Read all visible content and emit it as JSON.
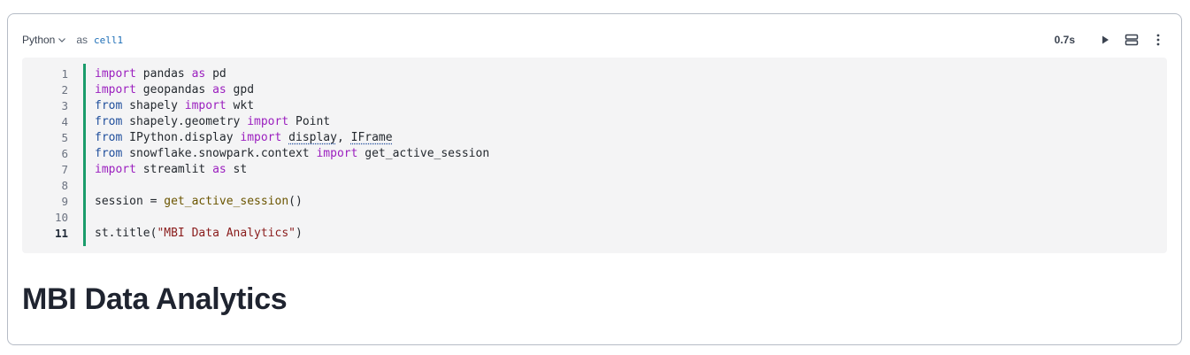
{
  "header": {
    "language": "Python",
    "as_word": "as",
    "cell_name": "cell1",
    "duration": "0.7s",
    "icons": {
      "language_dropdown": "chevron-down-icon",
      "run": "play-icon",
      "layout": "split-icon",
      "more": "more-vertical-icon"
    }
  },
  "editor": {
    "line_numbers": [
      "1",
      "2",
      "3",
      "4",
      "5",
      "6",
      "7",
      "8",
      "9",
      "10",
      "11"
    ],
    "active_line": "11",
    "accent_color": "#1a9c6b",
    "lines": [
      [
        {
          "t": "import",
          "c": "kw"
        },
        {
          "t": " pandas ",
          "c": ""
        },
        {
          "t": "as",
          "c": "kw"
        },
        {
          "t": " pd",
          "c": ""
        }
      ],
      [
        {
          "t": "import",
          "c": "kw"
        },
        {
          "t": " geopandas ",
          "c": ""
        },
        {
          "t": "as",
          "c": "kw"
        },
        {
          "t": " gpd",
          "c": ""
        }
      ],
      [
        {
          "t": "from",
          "c": "kw2"
        },
        {
          "t": " shapely ",
          "c": ""
        },
        {
          "t": "import",
          "c": "kw"
        },
        {
          "t": " wkt",
          "c": ""
        }
      ],
      [
        {
          "t": "from",
          "c": "kw2"
        },
        {
          "t": " shapely.geometry ",
          "c": ""
        },
        {
          "t": "import",
          "c": "kw"
        },
        {
          "t": " Point",
          "c": ""
        }
      ],
      [
        {
          "t": "from",
          "c": "kw2"
        },
        {
          "t": " IPython.display ",
          "c": ""
        },
        {
          "t": "import",
          "c": "kw"
        },
        {
          "t": " ",
          "c": ""
        },
        {
          "t": "display",
          "c": "und"
        },
        {
          "t": ", ",
          "c": ""
        },
        {
          "t": "IFrame",
          "c": "und"
        }
      ],
      [
        {
          "t": "from",
          "c": "kw2"
        },
        {
          "t": " snowflake.snowpark.context ",
          "c": ""
        },
        {
          "t": "import",
          "c": "kw"
        },
        {
          "t": " get_active_session",
          "c": ""
        }
      ],
      [
        {
          "t": "import",
          "c": "kw"
        },
        {
          "t": " streamlit ",
          "c": ""
        },
        {
          "t": "as",
          "c": "kw"
        },
        {
          "t": " st",
          "c": ""
        }
      ],
      [
        {
          "t": "",
          "c": ""
        }
      ],
      [
        {
          "t": "session = ",
          "c": ""
        },
        {
          "t": "get_active_session",
          "c": "fn"
        },
        {
          "t": "()",
          "c": ""
        }
      ],
      [
        {
          "t": "",
          "c": ""
        }
      ],
      [
        {
          "t": "st.title(",
          "c": ""
        },
        {
          "t": "\"MBI Data Analytics\"",
          "c": "str"
        },
        {
          "t": ")",
          "c": ""
        }
      ]
    ]
  },
  "output": {
    "title": "MBI Data Analytics"
  }
}
